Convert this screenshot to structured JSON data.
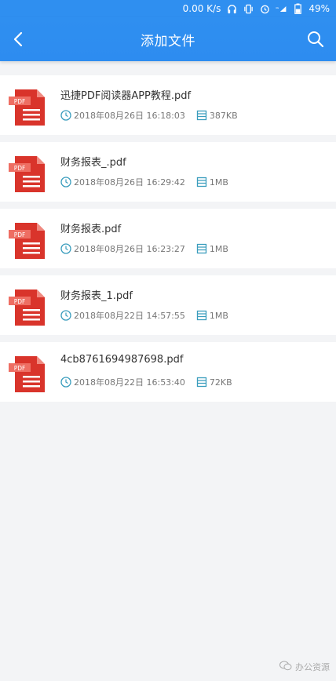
{
  "status_bar": {
    "speed": "0.00 K/s",
    "battery": "49%",
    "icons": [
      "headphones-icon",
      "vibrate-icon",
      "alarm-icon",
      "signal-icon"
    ]
  },
  "app_bar": {
    "title": "添加文件",
    "back_icon": "chevron-left-icon",
    "search_icon": "search-icon"
  },
  "files": [
    {
      "name": "迅捷PDF阅读器APP教程.pdf",
      "date": "2018年08月26日 16:18:03",
      "size": "387KB",
      "icon_label": "PDF"
    },
    {
      "name": "财务报表_.pdf",
      "date": "2018年08月26日 16:29:42",
      "size": "1MB",
      "icon_label": "PDF"
    },
    {
      "name": "财务报表.pdf",
      "date": "2018年08月26日 16:23:27",
      "size": "1MB",
      "icon_label": "PDF"
    },
    {
      "name": "财务报表_1.pdf",
      "date": "2018年08月22日 14:57:55",
      "size": "1MB",
      "icon_label": "PDF"
    },
    {
      "name": "4cb8761694987698.pdf",
      "date": "2018年08月22日 16:53:40",
      "size": "72KB",
      "icon_label": "PDF"
    }
  ],
  "colors": {
    "primary": "#2f8ff0",
    "pdf_red": "#d9342b",
    "meta_icon": "#3a9dbd"
  },
  "watermark": "办公资源"
}
